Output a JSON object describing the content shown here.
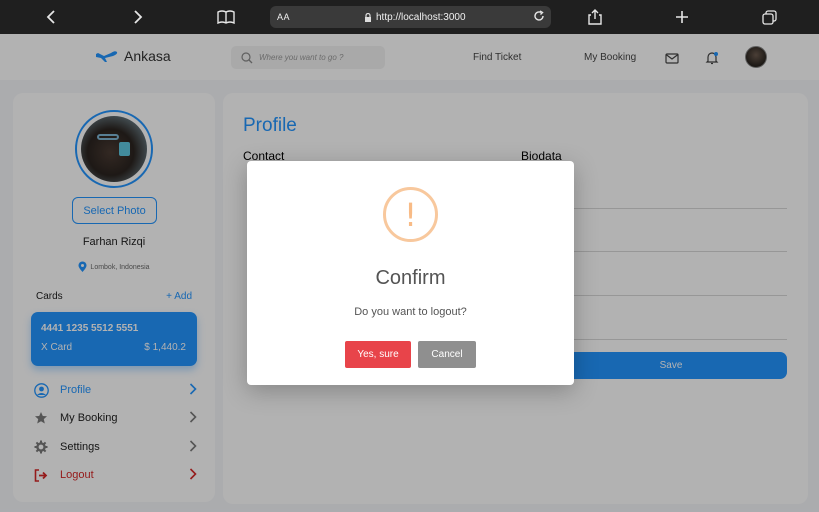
{
  "browser": {
    "text_size_label": "AA",
    "url": "http://localhost:3000"
  },
  "navbar": {
    "brand": "Ankasa",
    "search_placeholder": "Where you want to go ?",
    "find_ticket": "Find Ticket",
    "my_booking": "My Booking"
  },
  "sidebar": {
    "select_photo": "Select Photo",
    "user_name": "Farhan Rizqi",
    "location": "Lombok, Indonesia",
    "cards_label": "Cards",
    "add_label": "+ Add",
    "card": {
      "number": "4441 1235 5512 5551",
      "type": "X Card",
      "balance": "$ 1,440.2"
    },
    "menu": [
      {
        "label": "Profile",
        "icon": "user-circle-icon"
      },
      {
        "label": "My Booking",
        "icon": "star-icon"
      },
      {
        "label": "Settings",
        "icon": "gear-icon"
      },
      {
        "label": "Logout",
        "icon": "logout-icon"
      }
    ]
  },
  "main": {
    "title": "Profile",
    "contact_label": "Contact",
    "biodata_label": "Biodata",
    "save_label": "Save"
  },
  "modal": {
    "title": "Confirm",
    "message": "Do you want to logout?",
    "confirm_label": "Yes, sure",
    "cancel_label": "Cancel",
    "icon": "warning-icon"
  },
  "colors": {
    "primary": "#2395ff",
    "danger": "#e8444a",
    "warning": "#f8bb86",
    "neutral_button": "#8f8f8f"
  }
}
